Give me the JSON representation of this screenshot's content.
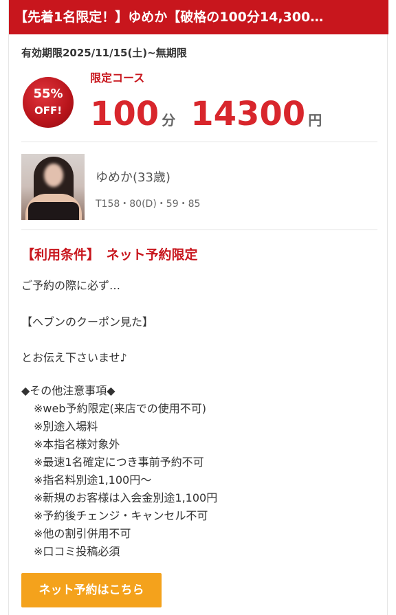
{
  "header": {
    "title": "【先着1名限定！】ゆめか【破格の100分14,300…"
  },
  "expiry": "有効期限2025/11/15(土)~無期限",
  "badge": {
    "percent": "55%",
    "off": "OFF!"
  },
  "course": {
    "label": "限定コース",
    "minutes": "100",
    "minutes_unit": "分",
    "price": "14300",
    "price_unit": "円"
  },
  "profile": {
    "name": "ゆめか(33歳)",
    "stats": "T158・80(D)・59・85"
  },
  "conditions": {
    "heading": "【利用条件】　ネット予約限定"
  },
  "message": {
    "line1": "ご予約の際に必ず…",
    "line2": "【ヘブンのクーポン見た】",
    "line3": "とお伝え下さいませ♪"
  },
  "notes": {
    "heading": "◆その他注意事項◆",
    "items": [
      "※web予約限定(来店での使用不可)",
      "※別途入場料",
      "※本指名様対象外",
      "※最速1名確定につき事前予約不可",
      "※指名料別途1,100円～",
      "※新規のお客様は入会金別途1,100円",
      "※予約後チェンジ・キャンセル不可",
      "※他の割引併用不可",
      "※口コミ投稿必須"
    ]
  },
  "cta": {
    "label": "ネット予約はこちら"
  },
  "colors": {
    "brand_red": "#c8161d",
    "price_red": "#d8262c",
    "cta_orange": "#f4a21c"
  }
}
